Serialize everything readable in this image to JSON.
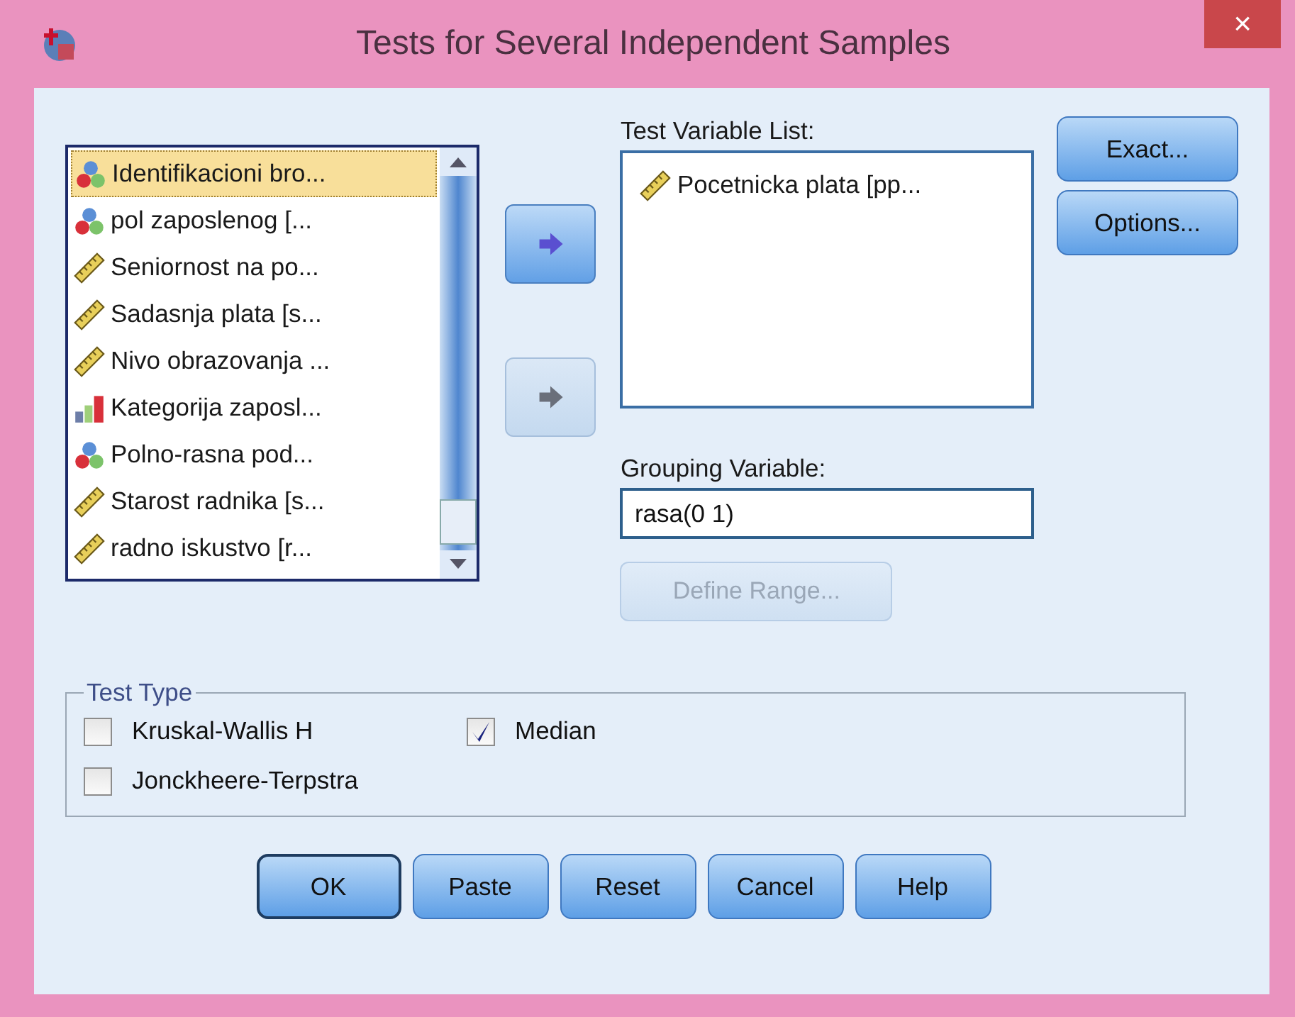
{
  "window": {
    "title": "Tests for Several Independent Samples",
    "close": "×"
  },
  "variables": [
    {
      "label": "Identifikacioni bro...",
      "kind": "nominal",
      "selected": true
    },
    {
      "label": "pol zaposlenog [...",
      "kind": "nominal",
      "selected": false
    },
    {
      "label": "Seniornost na po...",
      "kind": "scale",
      "selected": false
    },
    {
      "label": "Sadasnja plata [s...",
      "kind": "scale",
      "selected": false
    },
    {
      "label": "Nivo obrazovanja ...",
      "kind": "scale",
      "selected": false
    },
    {
      "label": "Kategorija zaposl...",
      "kind": "ordinal",
      "selected": false
    },
    {
      "label": "Polno-rasna pod...",
      "kind": "nominal",
      "selected": false
    },
    {
      "label": "Starost radnika [s...",
      "kind": "scale",
      "selected": false
    },
    {
      "label": "radno iskustvo [r...",
      "kind": "scale",
      "selected": false
    }
  ],
  "test_variable_list": {
    "label": "Test Variable List:",
    "items": [
      {
        "label": "Pocetnicka plata [pp...",
        "kind": "scale"
      }
    ]
  },
  "move_buttons": [
    {
      "disabled": false
    },
    {
      "disabled": true
    }
  ],
  "grouping_variable": {
    "label": "Grouping Variable:",
    "value": "rasa(0 1)"
  },
  "define_range": {
    "label": "Define Range...",
    "disabled": true
  },
  "side_buttons": [
    "Exact...",
    "Options..."
  ],
  "test_type": {
    "title": "Test Type",
    "options": [
      {
        "label": "Kruskal-Wallis H",
        "checked": false
      },
      {
        "label": "Median",
        "checked": true
      },
      {
        "label": "Jonckheere-Terpstra",
        "checked": false
      }
    ]
  },
  "buttons": [
    {
      "label": "OK",
      "default": true
    },
    {
      "label": "Paste",
      "default": false
    },
    {
      "label": "Reset",
      "default": false
    },
    {
      "label": "Cancel",
      "default": false
    },
    {
      "label": "Help",
      "default": false
    }
  ]
}
